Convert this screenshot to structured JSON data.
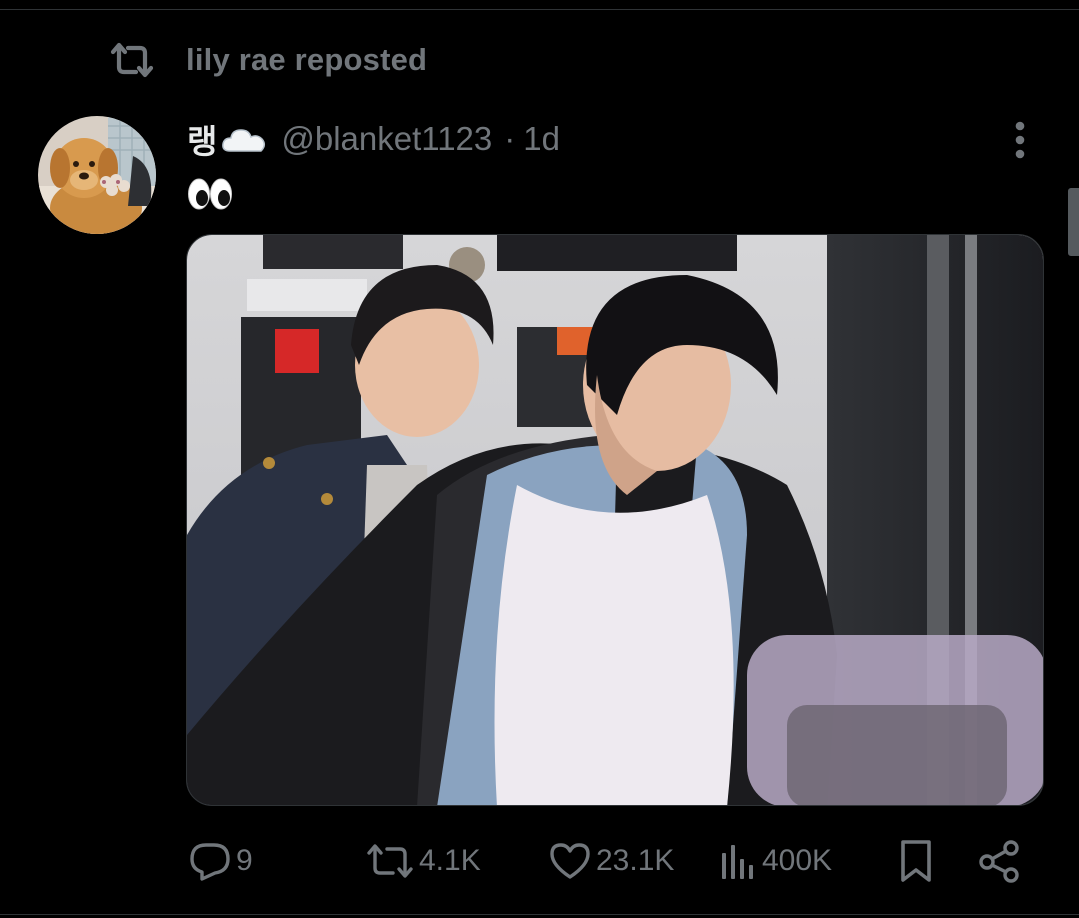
{
  "repost_banner": {
    "text": "lily rae reposted",
    "icon": "repost-icon"
  },
  "post": {
    "display_name": "랭",
    "name_emoji": "cloud-icon",
    "handle": "@blanket1123",
    "separator": "·",
    "time": "1d",
    "text_emoji": "eyes-icon",
    "media": {
      "type": "photo",
      "alt": ""
    }
  },
  "actions": {
    "replies": "9",
    "reposts": "4.1K",
    "likes": "23.1K",
    "views": "400K"
  },
  "colors": {
    "background": "#000000",
    "text": "#e7e9ea",
    "muted": "#71767b",
    "divider": "#2f3336"
  }
}
